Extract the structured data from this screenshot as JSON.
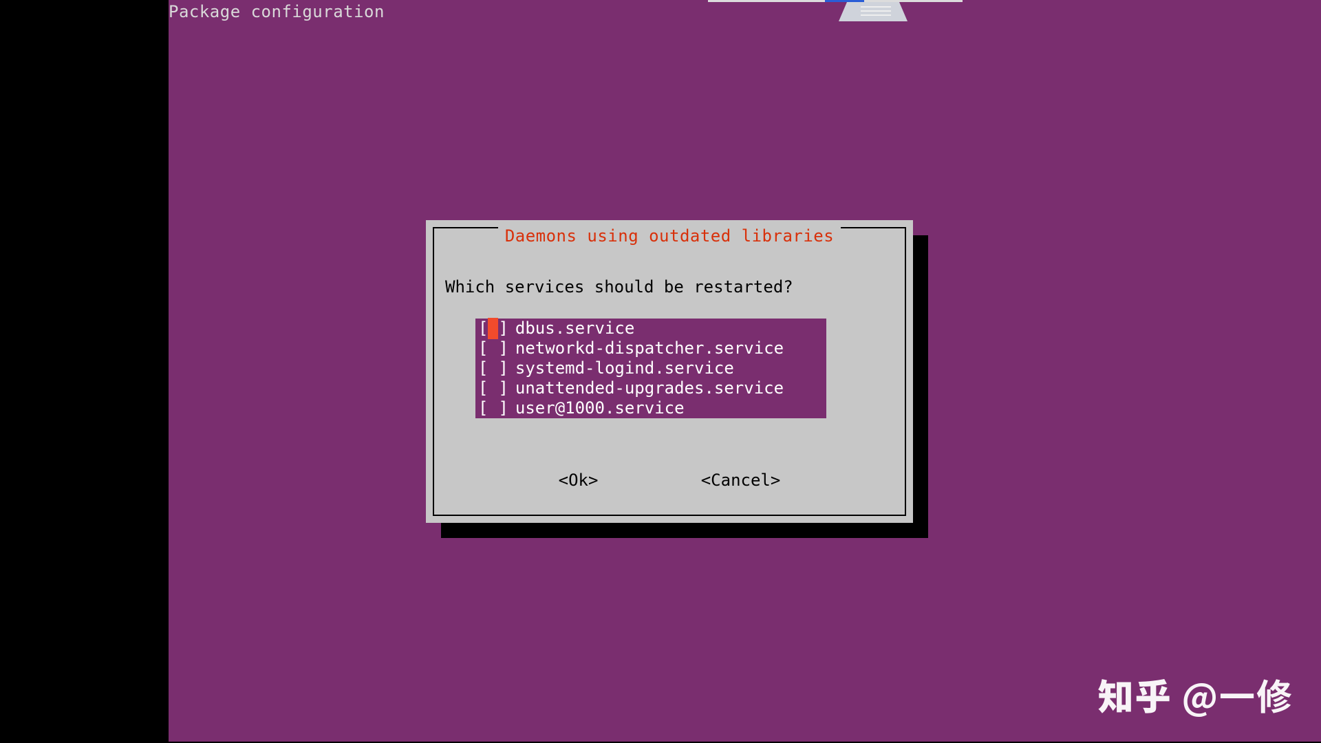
{
  "header": {
    "title": "Package configuration"
  },
  "dialog": {
    "title": " Daemons using outdated libraries ",
    "prompt": "Which services should be restarted?",
    "services": [
      {
        "label": "dbus.service",
        "checked": false,
        "cursor": true
      },
      {
        "label": "networkd-dispatcher.service",
        "checked": false,
        "cursor": false
      },
      {
        "label": "systemd-logind.service",
        "checked": false,
        "cursor": false
      },
      {
        "label": "unattended-upgrades.service",
        "checked": false,
        "cursor": false
      },
      {
        "label": "user@1000.service",
        "checked": false,
        "cursor": false
      }
    ],
    "buttons": {
      "ok": "<Ok>",
      "cancel": "<Cancel>"
    }
  },
  "watermark": {
    "logo": "知乎",
    "text": "@一修"
  },
  "colors": {
    "background_purple": "#7a2e6f",
    "dialog_bg": "#c7c7c7",
    "title_red": "#d8300a",
    "cursor_orange": "#f24b2c"
  }
}
